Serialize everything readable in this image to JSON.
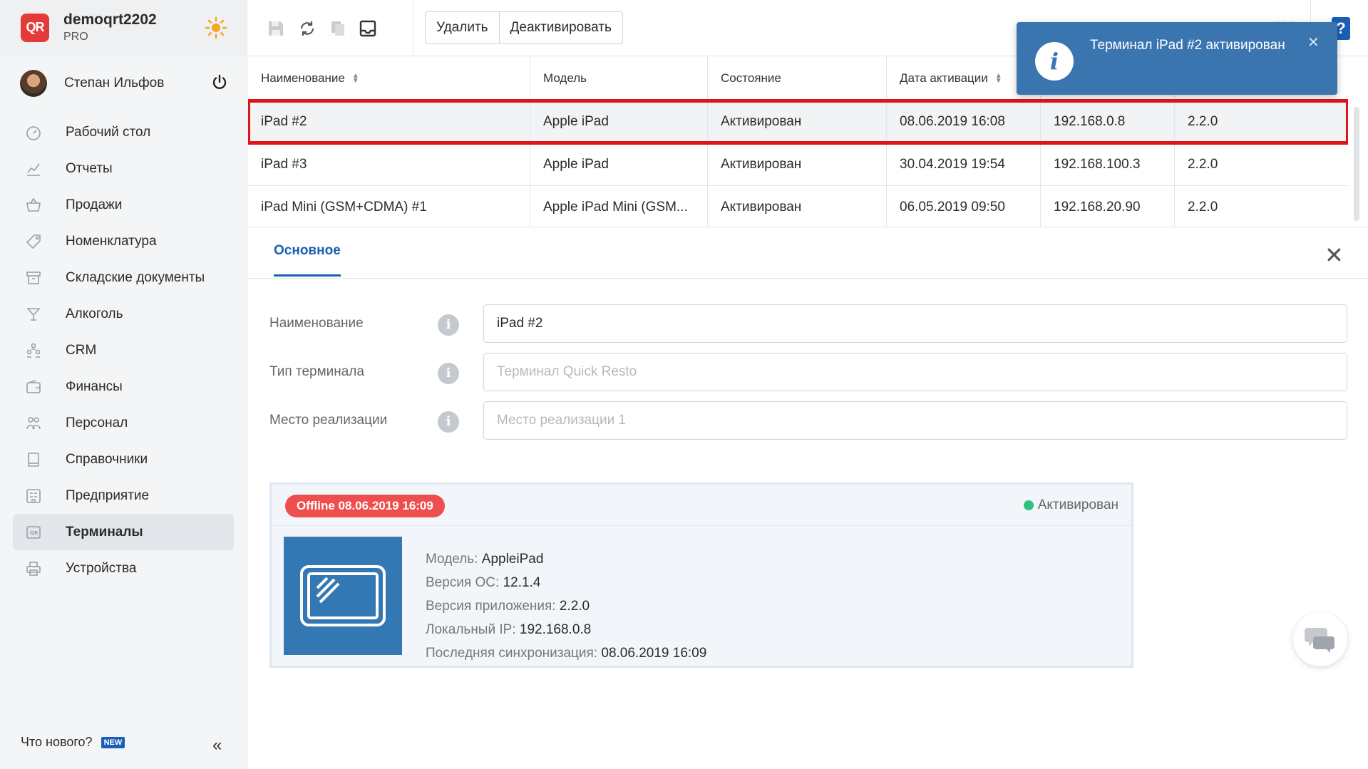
{
  "brand": {
    "name": "demoqrt2202",
    "plan": "PRO",
    "logo_text": "QR"
  },
  "user": {
    "name": "Степан Ильфов"
  },
  "nav": {
    "items": [
      {
        "label": "Рабочий стол",
        "icon": "dashboard-icon"
      },
      {
        "label": "Отчеты",
        "icon": "chart-icon"
      },
      {
        "label": "Продажи",
        "icon": "basket-icon"
      },
      {
        "label": "Номенклатура",
        "icon": "tag-icon"
      },
      {
        "label": "Складские документы",
        "icon": "archive-icon"
      },
      {
        "label": "Алкоголь",
        "icon": "cocktail-icon"
      },
      {
        "label": "CRM",
        "icon": "people-icon"
      },
      {
        "label": "Финансы",
        "icon": "wallet-icon"
      },
      {
        "label": "Персонал",
        "icon": "staff-icon"
      },
      {
        "label": "Справочники",
        "icon": "book-icon"
      },
      {
        "label": "Предприятие",
        "icon": "building-icon"
      },
      {
        "label": "Терминалы",
        "icon": "terminal-icon",
        "active": true
      },
      {
        "label": "Устройства",
        "icon": "printer-icon"
      }
    ],
    "whats_new": "Что нового?",
    "new_badge": "NEW"
  },
  "toolbar": {
    "delete_label": "Удалить",
    "deactivate_label": "Деактивировать",
    "help_label": "?"
  },
  "table": {
    "headers": [
      "Наименование",
      "Модель",
      "Состояние",
      "Дата активации",
      "",
      ""
    ],
    "rows": [
      [
        "iPad #2",
        "Apple iPad",
        "Активирован",
        "08.06.2019 16:08",
        "192.168.0.8",
        "2.2.0"
      ],
      [
        "iPad #3",
        "Apple iPad",
        "Активирован",
        "30.04.2019 19:54",
        "192.168.100.3",
        "2.2.0"
      ],
      [
        "iPad Mini (GSM+CDMA) #1",
        "Apple iPad Mini (GSM...",
        "Активирован",
        "06.05.2019 09:50",
        "192.168.20.90",
        "2.2.0"
      ]
    ]
  },
  "panel": {
    "tab": "Основное",
    "fields": [
      {
        "label": "Наименование",
        "value": "iPad #2",
        "placeholder": ""
      },
      {
        "label": "Тип терминала",
        "value": "",
        "placeholder": "Терминал Quick Resto"
      },
      {
        "label": "Место реализации",
        "value": "",
        "placeholder": "Место реализации 1"
      }
    ],
    "card": {
      "offline": "Offline 08.06.2019 16:09",
      "status": "Активирован",
      "specs": [
        {
          "label": "Модель:",
          "value": "AppleiPad"
        },
        {
          "label": "Версия ОС:",
          "value": "12.1.4"
        },
        {
          "label": "Версия приложения:",
          "value": "2.2.0"
        },
        {
          "label": "Локальный IP:",
          "value": "192.168.0.8"
        },
        {
          "label": "Последняя синхронизация:",
          "value": "08.06.2019 16:09"
        }
      ]
    }
  },
  "toast": {
    "text": "Терминал iPad #2 активирован"
  },
  "colors": {
    "accent": "#1a5fb4",
    "toast": "#3a75b0",
    "selection": "#e0131b",
    "offline": "#ef4e4e",
    "active_dot": "#2ec27e"
  }
}
